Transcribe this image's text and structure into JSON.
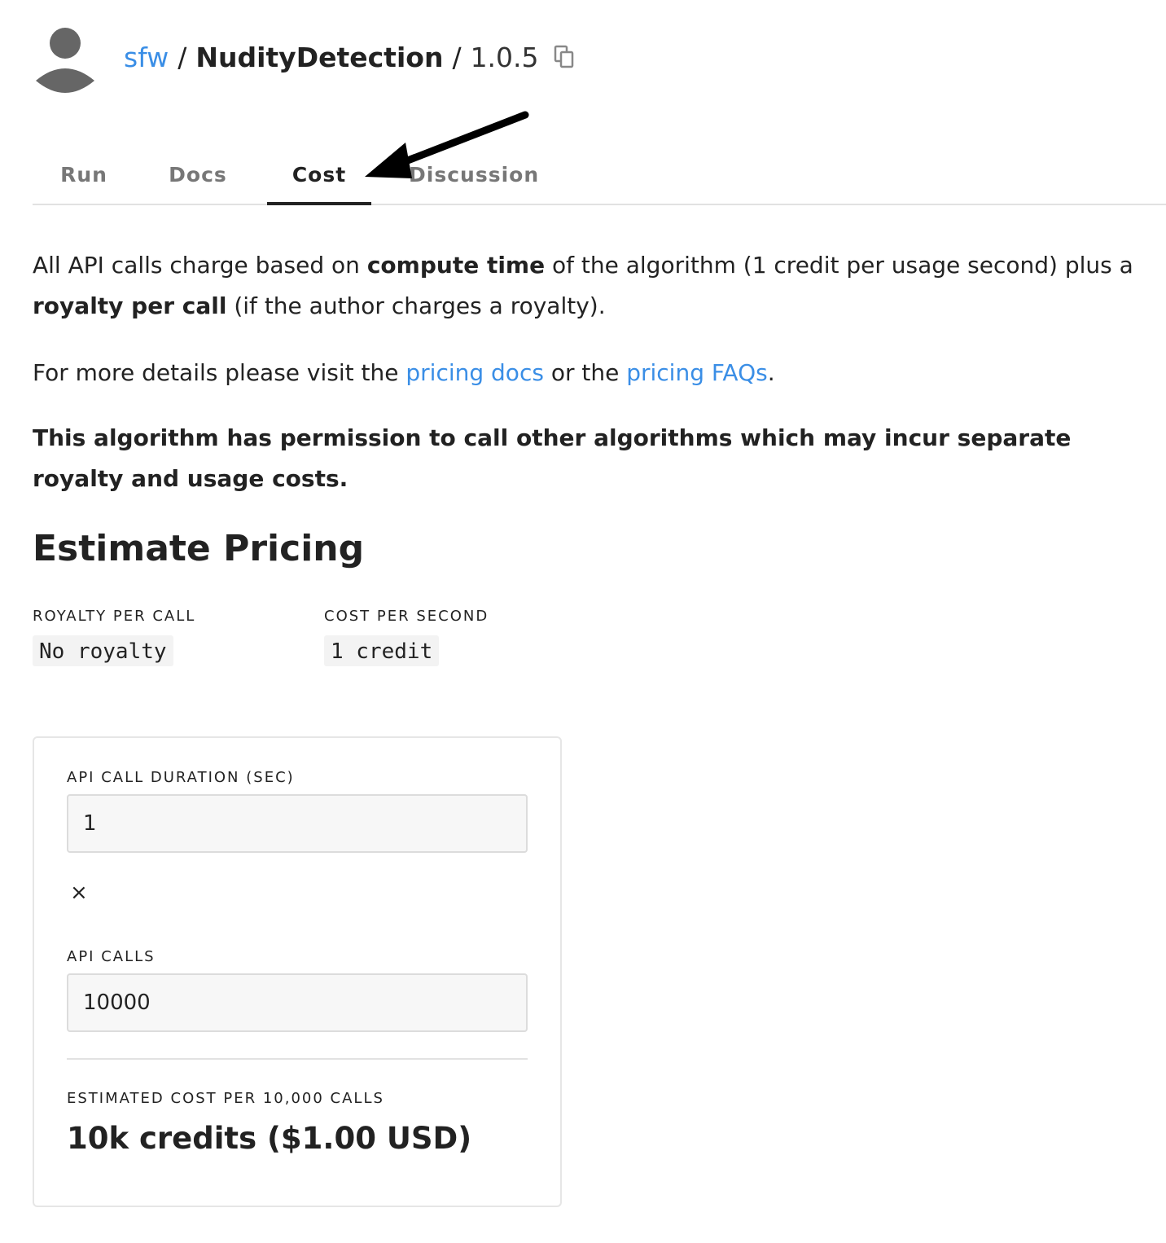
{
  "header": {
    "owner": "sfw",
    "separator": "/",
    "algorithm": "NudityDetection",
    "version": "1.0.5",
    "icons": {
      "avatar": "user-avatar-icon",
      "copy": "copy-icon"
    }
  },
  "tabs": [
    {
      "label": "Run",
      "active": false
    },
    {
      "label": "Docs",
      "active": false
    },
    {
      "label": "Cost",
      "active": true
    },
    {
      "label": "Discussion",
      "active": false
    }
  ],
  "cost_intro": {
    "text_1": "All API calls charge based on ",
    "bold_1": "compute time",
    "text_2": " of the algorithm (1 credit per usage second) plus a ",
    "bold_2": "royalty per call",
    "text_3": " (if the author charges a royalty)."
  },
  "details": {
    "text_1": "For more details please visit the ",
    "link_1": "pricing docs",
    "text_2": " or the ",
    "link_2": "pricing FAQs",
    "text_3": "."
  },
  "warning": "This algorithm has permission to call other algorithms which may incur separate royalty and usage costs.",
  "estimate": {
    "heading": "Estimate Pricing",
    "royalty_label": "ROYALTY PER CALL",
    "royalty_value": "No royalty",
    "cost_label": "COST PER SECOND",
    "cost_value": "1 credit"
  },
  "calculator": {
    "duration_label": "API CALL DURATION (SEC)",
    "duration_value": "1",
    "multiply_symbol": "×",
    "calls_label": "API CALLS",
    "calls_value": "10000",
    "result_label": "ESTIMATED COST PER 10,000 CALLS",
    "result_value": "10k credits ($1.00 USD)"
  },
  "colors": {
    "link": "#3a8ee6",
    "text": "#222222",
    "muted_tab": "#777777"
  }
}
